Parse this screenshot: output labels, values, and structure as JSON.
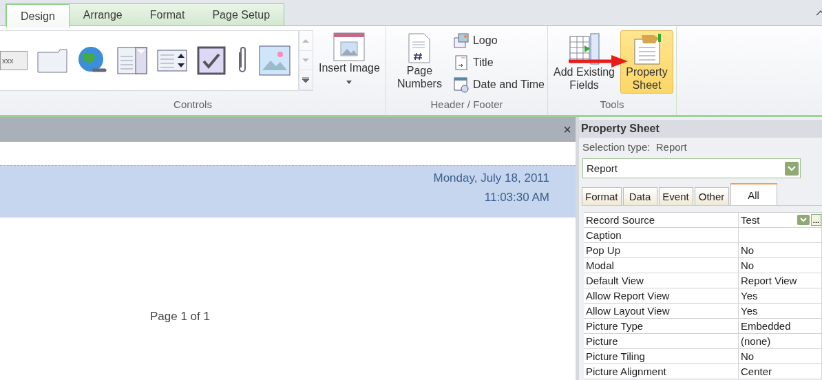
{
  "ribbon": {
    "tabs": [
      {
        "label": "Design",
        "selected": true
      },
      {
        "label": "Arrange",
        "selected": false
      },
      {
        "label": "Format",
        "selected": false
      },
      {
        "label": "Page Setup",
        "selected": false
      }
    ],
    "controls_gallery": {
      "text_control": "xxx"
    },
    "groups": [
      {
        "label": "Controls",
        "buttons": [
          {
            "kind": "large",
            "label": "Insert Image",
            "dropdown": true,
            "pressed": false
          }
        ]
      },
      {
        "label": "Header / Footer",
        "buttons": [
          {
            "kind": "large",
            "label": "Page Numbers",
            "pressed": false
          },
          {
            "kind": "small",
            "label": "Logo",
            "pressed": false
          },
          {
            "kind": "small",
            "label": "Title",
            "pressed": false
          },
          {
            "kind": "small",
            "label": "Date and Time",
            "pressed": false
          }
        ]
      },
      {
        "label": "Tools",
        "buttons": [
          {
            "kind": "large",
            "label": "Add Existing Fields",
            "pressed": false
          },
          {
            "kind": "large",
            "label": "Property Sheet",
            "pressed": true
          }
        ]
      }
    ]
  },
  "report": {
    "close": "×",
    "date": "Monday, July 18, 2011",
    "time": "11:03:30 AM",
    "footer": "Page 1 of 1"
  },
  "property_sheet": {
    "title": "Property Sheet",
    "selection_label": "Selection type:",
    "selection_value": "Report",
    "combo_value": "Report",
    "tabs": [
      {
        "label": "Format",
        "selected": false
      },
      {
        "label": "Data",
        "selected": false
      },
      {
        "label": "Event",
        "selected": false
      },
      {
        "label": "Other",
        "selected": false
      },
      {
        "label": "All",
        "selected": true
      }
    ],
    "rows": [
      {
        "name": "Record Source",
        "value": "Test",
        "builder": "..."
      },
      {
        "name": "Caption"
      },
      {
        "name": "Pop Up",
        "value": "No"
      },
      {
        "name": "Modal",
        "value": "No"
      },
      {
        "name": "Default View",
        "value": "Report View"
      },
      {
        "name": "Allow Report View",
        "value": "Yes"
      },
      {
        "name": "Allow Layout View",
        "value": "Yes"
      },
      {
        "name": "Picture Type",
        "value": "Embedded"
      },
      {
        "name": "Picture",
        "value": "(none)"
      },
      {
        "name": "Picture Tiling",
        "value": "No"
      },
      {
        "name": "Picture Alignment",
        "value": "Center"
      }
    ]
  }
}
